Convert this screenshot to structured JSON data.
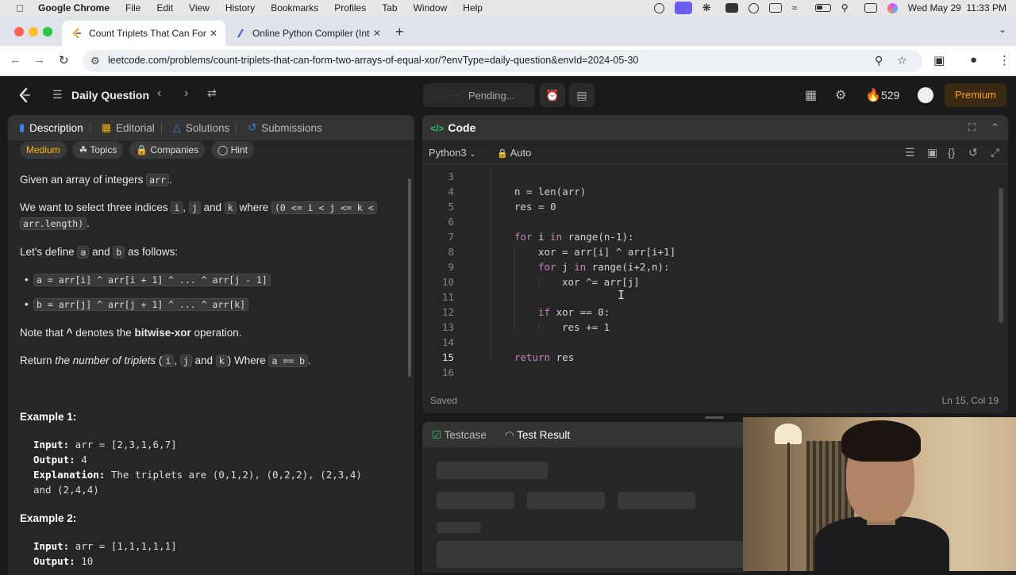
{
  "menubar": {
    "app": "Google Chrome",
    "items": [
      "File",
      "Edit",
      "View",
      "History",
      "Bookmarks",
      "Profiles",
      "Tab",
      "Window",
      "Help"
    ],
    "datetime": "Wed May 29  11:33 PM"
  },
  "tabs": [
    {
      "title": "Count Triplets That Can Form",
      "active": true
    },
    {
      "title": "Online Python Compiler (Inter",
      "active": false
    }
  ],
  "address": {
    "url": "leetcode.com/problems/count-triplets-that-can-form-two-arrays-of-equal-xor/?envType=daily-question&envId=2024-05-30"
  },
  "header": {
    "daily": "Daily Question",
    "run_status": "Pending...",
    "streak": "529",
    "premium": "Premium"
  },
  "left_tabs": [
    "Description",
    "Editorial",
    "Solutions",
    "Submissions"
  ],
  "tags": {
    "difficulty": "Medium",
    "topics": "Topics",
    "companies": "Companies",
    "hint": "Hint"
  },
  "description": {
    "p1_a": "Given an array of integers ",
    "p1_code": "arr",
    "p1_b": ".",
    "p2_a": "We want to select three indices ",
    "p2_i": "i",
    "p2_comma": ", ",
    "p2_j": "j",
    "p2_and": " and ",
    "p2_k": "k",
    "p2_where": " where ",
    "p2_cond1": "(0 <= i < j <= k <",
    "p2_cond2": "arr.length)",
    "p2_end": ".",
    "p3_a": "Let's define ",
    "p3_a_code": "a",
    "p3_and": " and ",
    "p3_b_code": "b",
    "p3_end": " as follows:",
    "bullet1": "a = arr[i] ^ arr[i + 1] ^ ... ^ arr[j - 1]",
    "bullet2": "b = arr[j] ^ arr[j + 1] ^ ... ^ arr[k]",
    "note_a": "Note that ",
    "note_op": "^",
    "note_b": " denotes the ",
    "note_bold": "bitwise-xor",
    "note_c": " operation.",
    "ret_a": "Return ",
    "ret_em": "the number of triplets",
    "ret_b": " (",
    "ret_i": "i",
    "ret_c": ", ",
    "ret_j": "j",
    "ret_d": " and ",
    "ret_k": "k",
    "ret_e": ") Where ",
    "ret_code": "a == b",
    "ret_f": "."
  },
  "examples": [
    {
      "title": "Example 1:",
      "input_label": "Input:",
      "input": " arr = [2,3,1,6,7]",
      "output_label": "Output:",
      "output": " 4",
      "expl_label": "Explanation:",
      "expl": " The triplets are (0,1,2), (0,2,2), (2,3,4)",
      "expl2": "and (2,4,4)"
    },
    {
      "title": "Example 2:",
      "input_label": "Input:",
      "input": " arr = [1,1,1,1,1]",
      "output_label": "Output:",
      "output": " 10"
    }
  ],
  "code_panel": {
    "title": "Code",
    "language": "Python3",
    "mode": "Auto",
    "status": "Saved",
    "cursor": "Ln 15, Col 19"
  },
  "code_lines": [
    {
      "n": "3",
      "text": ""
    },
    {
      "n": "4",
      "text": "n = len(arr)"
    },
    {
      "n": "5",
      "text": "res = 0"
    },
    {
      "n": "6",
      "text": ""
    },
    {
      "n": "7",
      "kw": "for",
      "text": " i ",
      "kw2": "in",
      "rest": " range(n-1):"
    },
    {
      "n": "8",
      "text": "xor = arr[i] ^ arr[i+1]"
    },
    {
      "n": "9",
      "kw": "for",
      "text": " j ",
      "kw2": "in",
      "rest": " range(i+2,n):"
    },
    {
      "n": "10",
      "text": "xor ^= arr[j]"
    },
    {
      "n": "11",
      "text": ""
    },
    {
      "n": "12",
      "kw": "if",
      "text": " xor == 0:"
    },
    {
      "n": "13",
      "text": "res += 1"
    },
    {
      "n": "14",
      "text": ""
    },
    {
      "n": "15",
      "kw": "return",
      "text": " res"
    },
    {
      "n": "16",
      "text": ""
    }
  ],
  "bottom_tabs": {
    "testcase": "Testcase",
    "result": "Test Result"
  }
}
